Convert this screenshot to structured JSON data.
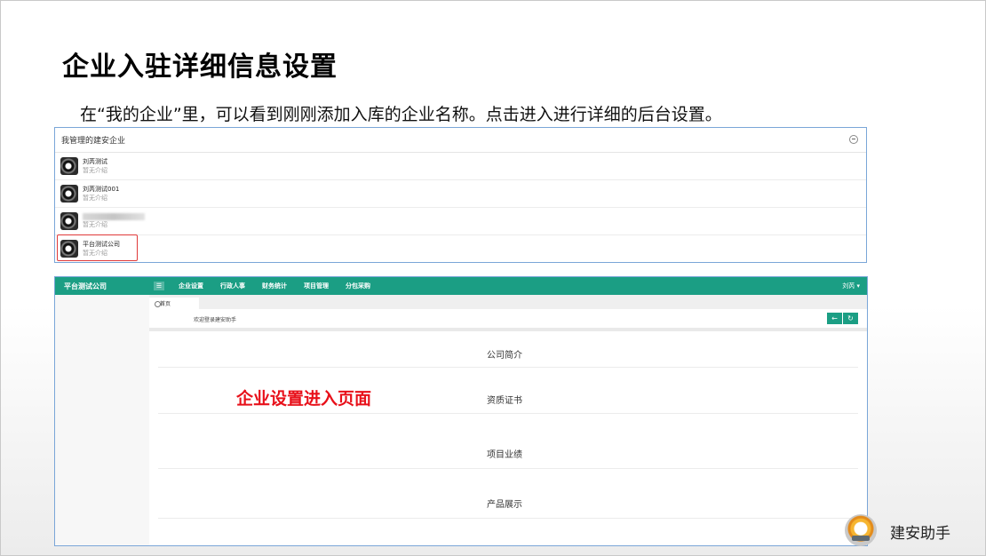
{
  "slide": {
    "title": "企业入驻详细信息设置",
    "subtitle": "在“我的企业”里，可以看到刚刚添加入库的企业名称。点击进入进行详细的后台设置。"
  },
  "panel1": {
    "header": "我管理的建安企业",
    "companies": [
      {
        "name": "刘芮测试",
        "desc": "暂无介绍"
      },
      {
        "name": "刘芮测试001",
        "desc": "暂无介绍"
      },
      {
        "name": "",
        "desc": "暂无介绍"
      },
      {
        "name": "平台测试公司",
        "desc": "暂无介绍"
      }
    ]
  },
  "panel2": {
    "brand": "平台测试公司",
    "menu_icon": "☰",
    "nav": [
      "企业设置",
      "行政人事",
      "财务统计",
      "项目管理",
      "分包采购"
    ],
    "user_menu": "刘芮 ▾",
    "tab_home": "首页",
    "welcome": "欢迎登录建安助手",
    "back_icon": "←",
    "refresh_icon": "↻",
    "sections": [
      "公司简介",
      "资质证书",
      "项目业绩",
      "产品展示"
    ],
    "annotation": "企业设置进入页面",
    "annotation_color": "#e8101a",
    "accent_color": "#1b9e84"
  },
  "footer": {
    "brand_name": "建安助手"
  }
}
